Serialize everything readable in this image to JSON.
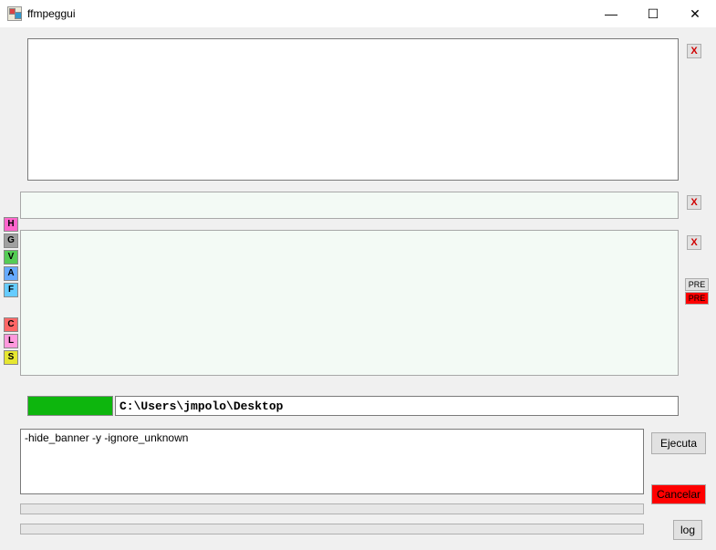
{
  "window": {
    "title": "ffmpeggui"
  },
  "buttons": {
    "x": "X",
    "pre": "PRE",
    "pre2": "PRE",
    "ejecuta": "Ejecuta",
    "cancelar": "Cancelar",
    "log": "log"
  },
  "side": {
    "h": "H",
    "g": "G",
    "v": "V",
    "a": "A",
    "f": "F",
    "c": "C",
    "l": "L",
    "s": "S"
  },
  "side_colors": {
    "h": "#ff66cc",
    "g": "#a0a0a0",
    "v": "#55cc55",
    "a": "#66aaff",
    "f": "#66ccff",
    "c": "#ff6666",
    "l": "#ff99dd",
    "s": "#e6e630"
  },
  "path": {
    "value": "C:\\Users\\jmpolo\\Desktop"
  },
  "command": {
    "value": "-hide_banner -y -ignore_unknown"
  },
  "textboxes": {
    "top": "",
    "mid1": "",
    "mid2": ""
  }
}
